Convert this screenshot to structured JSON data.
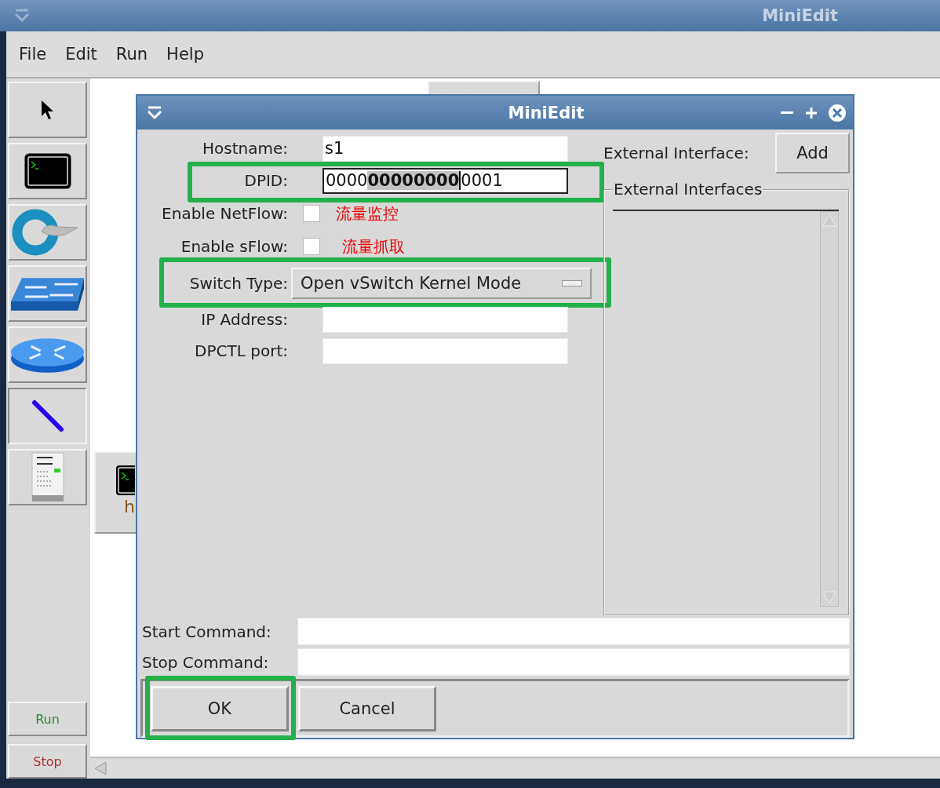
{
  "window": {
    "title": "MiniEdit"
  },
  "menu": [
    "File",
    "Edit",
    "Run",
    "Help"
  ],
  "tools": [
    {
      "kind": "select",
      "selected": false
    },
    {
      "kind": "host",
      "selected": false
    },
    {
      "kind": "controller",
      "selected": false
    },
    {
      "kind": "switch",
      "selected": false
    },
    {
      "kind": "router",
      "selected": false
    },
    {
      "kind": "link",
      "selected": true
    },
    {
      "kind": "legacy",
      "selected": false
    }
  ],
  "run_buttons": [
    {
      "label": "Run",
      "color": "#2e8b2e"
    },
    {
      "label": "Stop",
      "color": "#b03030"
    }
  ],
  "canvas_nodes": [
    {
      "kind": "host",
      "label": "h"
    }
  ],
  "dialog": {
    "title": "MiniEdit",
    "fields": [
      {
        "kind": "text",
        "label": "Hostname:",
        "value": "s1",
        "highlighted": false
      },
      {
        "kind": "selection",
        "label": "DPID:",
        "before": "0000",
        "selected_text": "00000000",
        "after": "0001",
        "highlighted": true
      },
      {
        "kind": "checkbox",
        "label": "Enable NetFlow:",
        "checked": false,
        "note": "流量监控"
      },
      {
        "kind": "checkbox",
        "label": "Enable sFlow:",
        "checked": false,
        "note": "流量抓取"
      },
      {
        "kind": "menu",
        "label": "Switch Type:",
        "value": "Open vSwitch Kernel Mode",
        "highlighted": true
      },
      {
        "kind": "text",
        "label": "IP Address:",
        "highlighted": false
      },
      {
        "kind": "text",
        "label": "DPCTL port:",
        "highlighted": false
      }
    ],
    "external_interface_label": "External Interface:",
    "add_button": "Add",
    "interfaces_group": "External Interfaces",
    "commands": [
      {
        "label": "Start Command:"
      },
      {
        "label": "Stop Command:"
      }
    ],
    "buttons": [
      {
        "label": "OK",
        "highlighted": true
      },
      {
        "label": "Cancel",
        "highlighted": false
      }
    ]
  }
}
